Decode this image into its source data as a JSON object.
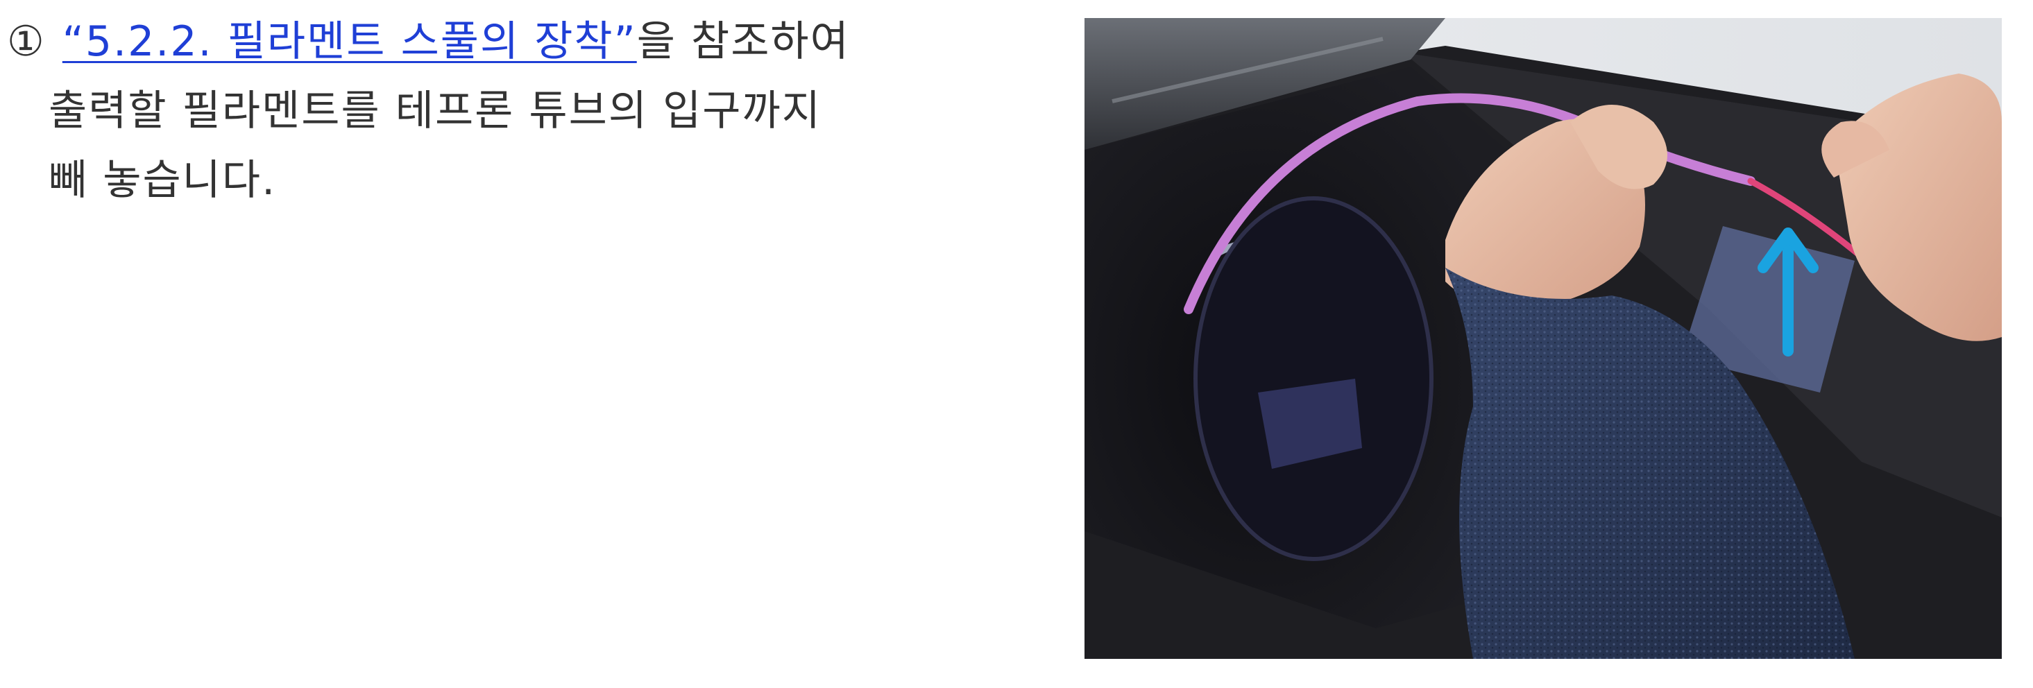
{
  "instruction": {
    "step_number": "①",
    "link_text": "“5.2.2. 필라멘트 스풀의 장착”",
    "after_link": "을 참조하여",
    "line2": "출력할 필라멘트를 테프론 튜브의 입구까지",
    "line3": "빼 놓습니다."
  },
  "photo": {
    "arrow_color": "#1aa3e0",
    "filament_color": "#c77fd6",
    "filament_tip_color": "#e0457a"
  }
}
